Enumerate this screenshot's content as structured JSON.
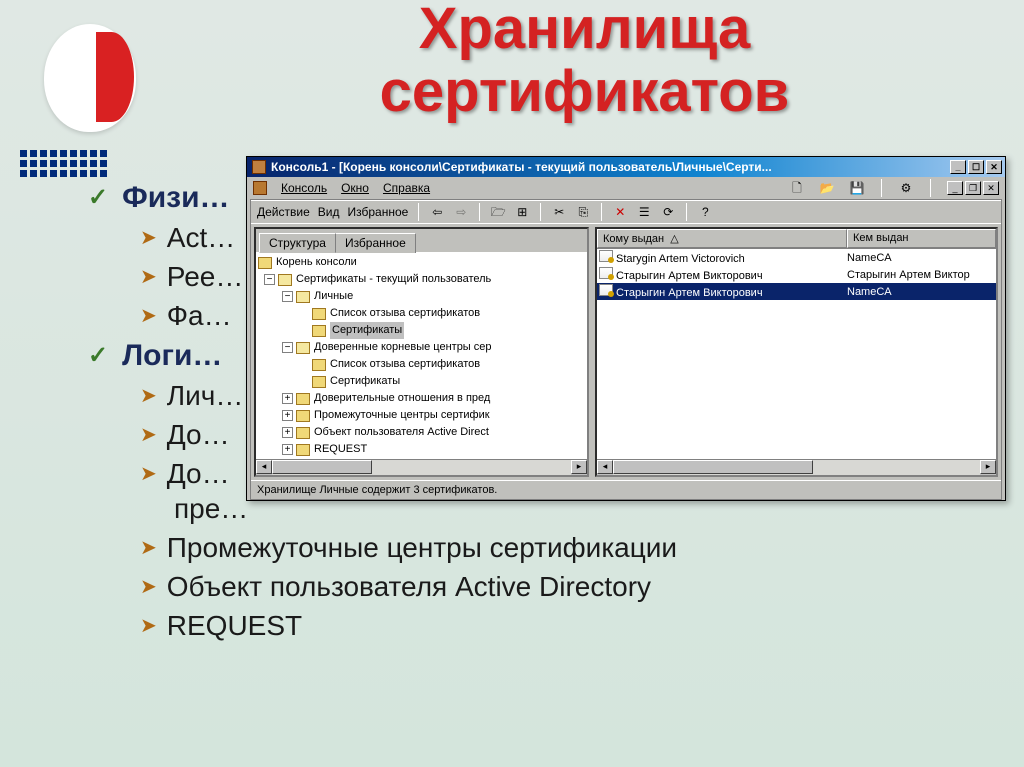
{
  "slide": {
    "title_line1": "Хранилища",
    "title_line2": "сертификатов",
    "bullets": [
      {
        "level": 0,
        "marker": "check",
        "text": "Физи…"
      },
      {
        "level": 1,
        "marker": "arrow",
        "text": "Act…"
      },
      {
        "level": 1,
        "marker": "arrow",
        "text": "Рее…"
      },
      {
        "level": 1,
        "marker": "arrow",
        "text": "Фа…"
      },
      {
        "level": 0,
        "marker": "check",
        "text": "Логи…"
      },
      {
        "level": 1,
        "marker": "arrow",
        "text": "Лич…"
      },
      {
        "level": 1,
        "marker": "arrow",
        "text": "До…"
      },
      {
        "level": 1,
        "marker": "arrow",
        "text": "До…"
      },
      {
        "level": 2,
        "marker": "",
        "text": "пре…"
      },
      {
        "level": 1,
        "marker": "arrow",
        "text": "Промежуточные центры сертификации"
      },
      {
        "level": 1,
        "marker": "arrow",
        "text": "Объект пользователя Active Directory"
      },
      {
        "level": 1,
        "marker": "arrow",
        "text": "REQUEST"
      }
    ]
  },
  "mmc": {
    "titlebar": "Консоль1 - [Корень консоли\\Сертификаты - текущий пользователь\\Личные\\Серти...",
    "menus": {
      "console": "Консоль",
      "window": "Окно",
      "help": "Справка"
    },
    "toolbar2": {
      "action": "Действие",
      "view": "Вид",
      "favorites": "Избранное"
    },
    "tabs": {
      "structure": "Структура",
      "favorites": "Избранное"
    },
    "tree": [
      {
        "depth": 0,
        "kind": "folder",
        "label": "Корень консоли"
      },
      {
        "depth": 1,
        "kind": "folder-open",
        "exp": "-",
        "label": "Сертификаты - текущий пользователь"
      },
      {
        "depth": 2,
        "kind": "folder-open",
        "exp": "-",
        "label": "Личные"
      },
      {
        "depth": 3,
        "kind": "folder",
        "label": "Список отзыва сертификатов"
      },
      {
        "depth": 3,
        "kind": "folder",
        "label": "Сертификаты",
        "selected": true
      },
      {
        "depth": 2,
        "kind": "folder-open",
        "exp": "-",
        "label": "Доверенные корневые центры сер"
      },
      {
        "depth": 3,
        "kind": "folder",
        "label": "Список отзыва сертификатов"
      },
      {
        "depth": 3,
        "kind": "folder",
        "label": "Сертификаты"
      },
      {
        "depth": 2,
        "kind": "folder",
        "exp": "+",
        "label": "Доверительные отношения в пред"
      },
      {
        "depth": 2,
        "kind": "folder",
        "exp": "+",
        "label": "Промежуточные центры сертифик"
      },
      {
        "depth": 2,
        "kind": "folder",
        "exp": "+",
        "label": "Объект пользователя Active Direct"
      },
      {
        "depth": 2,
        "kind": "folder",
        "exp": "+",
        "label": "REQUEST"
      }
    ],
    "list": {
      "columns": {
        "issued_to": "Кому выдан",
        "issued_by": "Кем выдан"
      },
      "rows": [
        {
          "issued_to": "Starygin Artem Victorovich",
          "issued_by": "NameCA"
        },
        {
          "issued_to": "Старыгин Артем Викторович",
          "issued_by": "Старыгин Артем Виктор"
        },
        {
          "issued_to": "Старыгин Артем Викторович",
          "issued_by": "NameCA",
          "selected": true
        }
      ]
    },
    "status": "Хранилище Личные содержит 3 сертификатов."
  }
}
